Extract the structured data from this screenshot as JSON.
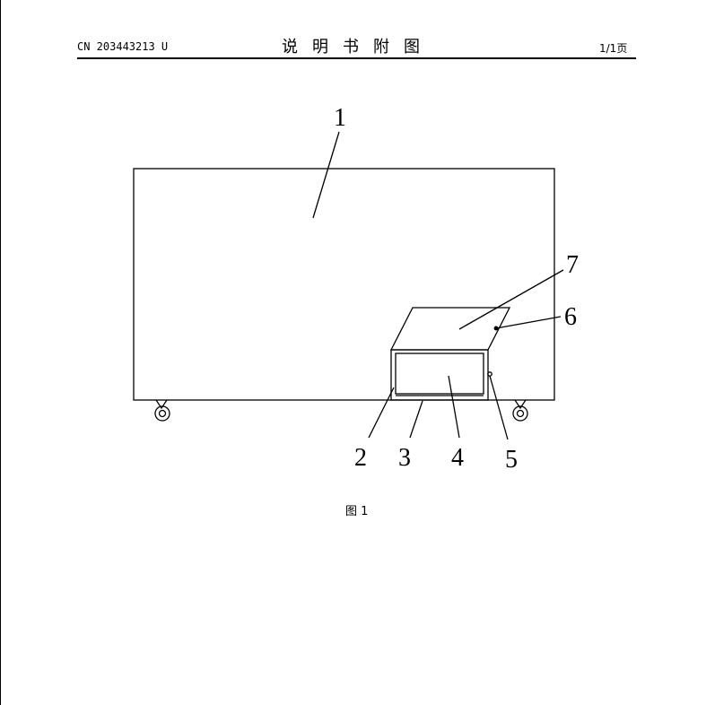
{
  "header": {
    "doc_number": "CN 203443213 U",
    "title": "说明书附图",
    "page_indicator": "1/1页"
  },
  "figure": {
    "caption": "图 1",
    "reference_numerals": [
      "1",
      "2",
      "3",
      "4",
      "5",
      "6",
      "7"
    ]
  }
}
